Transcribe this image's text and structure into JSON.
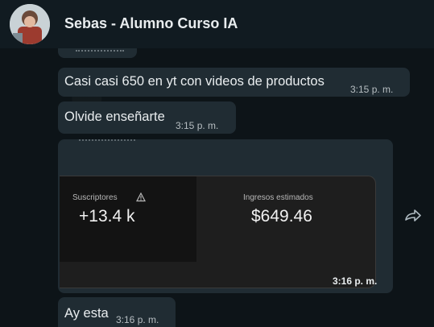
{
  "contact": {
    "name": "Sebas - Alumno Curso IA"
  },
  "messages": [
    {
      "text": "Casi casi 650 en yt con videos de productos",
      "time": "3:15 p. m."
    },
    {
      "text": "Olvide enseñarte",
      "time": "3:15 p. m."
    },
    {
      "time": "3:16 p. m."
    },
    {
      "text": "Ay esta",
      "time": "3:16 p. m."
    }
  ],
  "screenshot": {
    "subscribers_label": "Suscriptores",
    "subscribers_value": "+13.4 k",
    "revenue_label": "Ingresos estimados",
    "revenue_value": "$649.46"
  },
  "icons": {
    "warning": "warning-icon",
    "forward": "forward-icon"
  },
  "colors": {
    "incoming_bubble": "#202c33",
    "header": "#111b21",
    "timestamp": "#b7bec2"
  }
}
